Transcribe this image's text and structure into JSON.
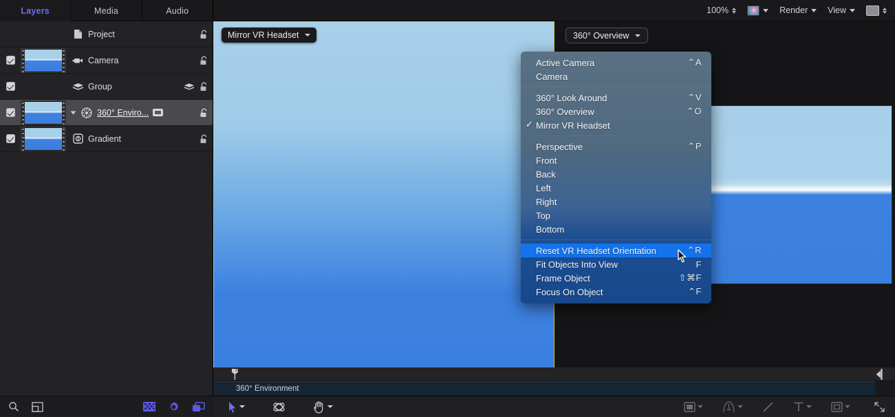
{
  "tabs": [
    {
      "label": "Layers",
      "active": true
    },
    {
      "label": "Media",
      "active": false
    },
    {
      "label": "Audio",
      "active": false
    }
  ],
  "layers": [
    {
      "name": "Project",
      "icon": "document-icon",
      "has_checkbox": false,
      "has_thumb": false,
      "selected": false,
      "editing": false,
      "badge": false,
      "group_icon": false
    },
    {
      "name": "Camera",
      "icon": "camera-icon",
      "has_checkbox": true,
      "has_thumb": true,
      "selected": false,
      "editing": false,
      "badge": false,
      "group_icon": false
    },
    {
      "name": "Group",
      "icon": "group-icon",
      "has_checkbox": true,
      "has_thumb": false,
      "selected": false,
      "editing": false,
      "badge": false,
      "group_icon": true
    },
    {
      "name": "360° Enviro...",
      "icon": "environment-icon",
      "has_checkbox": true,
      "has_thumb": true,
      "selected": true,
      "editing": true,
      "badge": true,
      "group_icon": false
    },
    {
      "name": "Gradient",
      "icon": "gradient-icon",
      "has_checkbox": true,
      "has_thumb": true,
      "selected": false,
      "editing": false,
      "badge": false,
      "group_icon": false
    }
  ],
  "panel_bottom": {
    "search_icon": "search-icon",
    "new_group_icon": "new-group-icon",
    "checkerboard_icon": "checkerboard-icon",
    "gear_icon": "render-settings-icon",
    "layers_stack_icon": "layers-stack-icon"
  },
  "toolbar": {
    "zoom_value": "100%",
    "color_swatch_icon": "color-profile-icon",
    "render_label": "Render",
    "view_label": "View",
    "mask_icon": "view-layout-icon"
  },
  "viewports": {
    "left_label": "Mirror VR Headset",
    "right_label": "360° Overview"
  },
  "menu": {
    "groups": [
      {
        "items": [
          {
            "label": "Active Camera",
            "shortcut": "⌃A",
            "checked": false,
            "highlighted": false
          },
          {
            "label": "Camera",
            "shortcut": "",
            "checked": false,
            "highlighted": false
          }
        ]
      },
      {
        "items": [
          {
            "label": "360° Look Around",
            "shortcut": "⌃V",
            "checked": false,
            "highlighted": false
          },
          {
            "label": "360° Overview",
            "shortcut": "⌃O",
            "checked": false,
            "highlighted": false
          },
          {
            "label": "Mirror VR Headset",
            "shortcut": "",
            "checked": true,
            "highlighted": false
          }
        ]
      },
      {
        "items": [
          {
            "label": "Perspective",
            "shortcut": "⌃P",
            "checked": false,
            "highlighted": false
          },
          {
            "label": "Front",
            "shortcut": "",
            "checked": false,
            "highlighted": false
          },
          {
            "label": "Back",
            "shortcut": "",
            "checked": false,
            "highlighted": false
          },
          {
            "label": "Left",
            "shortcut": "",
            "checked": false,
            "highlighted": false
          },
          {
            "label": "Right",
            "shortcut": "",
            "checked": false,
            "highlighted": false
          },
          {
            "label": "Top",
            "shortcut": "",
            "checked": false,
            "highlighted": false
          },
          {
            "label": "Bottom",
            "shortcut": "",
            "checked": false,
            "highlighted": false
          }
        ]
      },
      {
        "items": [
          {
            "label": "Reset VR Headset Orientation",
            "shortcut": "⌃R",
            "checked": false,
            "highlighted": true
          },
          {
            "label": "Fit Objects Into View",
            "shortcut": "F",
            "checked": false,
            "highlighted": false
          },
          {
            "label": "Frame Object",
            "shortcut": "⇧⌘F",
            "checked": false,
            "highlighted": false
          },
          {
            "label": "Focus On Object",
            "shortcut": "⌃F",
            "checked": false,
            "highlighted": false
          }
        ]
      }
    ]
  },
  "timeline": {
    "track_label": "360° Environment",
    "playhead_icon": "playhead-marker",
    "end_marker_icon": "end-of-project-marker"
  },
  "bottom_toolbar": {
    "select_tool": "select-arrow-tool",
    "orbit_tool": "3d-orbit-tool",
    "pan_tool": "pan-hand-tool",
    "shape_tool": "rectangle-shape-tool",
    "pen_tool": "bezier-pen-tool",
    "line_tool": "line-tool",
    "text_tool": "text-tool",
    "mask_tool": "mask-tool",
    "resize_icon": "resize-grip-icon"
  },
  "colors": {
    "accent_purple": "#6f6cf8",
    "menu_highlight": "#1473ec",
    "viewport_border": "#c8c84a",
    "sky_top": "#a9d0e9",
    "sky_bottom": "#3b7fe0"
  }
}
